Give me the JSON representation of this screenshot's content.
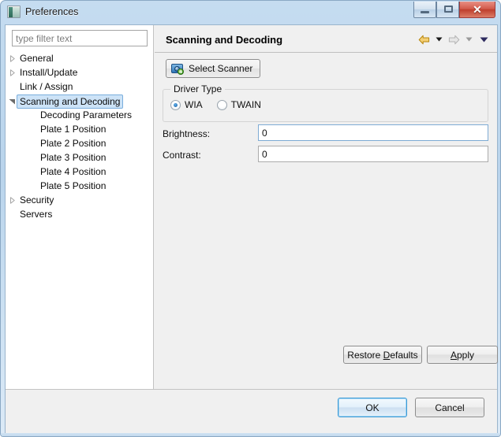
{
  "window": {
    "title": "Preferences",
    "icon": "preferences-window-icon",
    "controls": {
      "minimize": "minimize-icon",
      "maximize": "restore-icon",
      "close_label": "✕"
    }
  },
  "sidebar": {
    "filter": {
      "placeholder": "type filter text",
      "value": ""
    },
    "items": [
      {
        "label": "General",
        "indent": 0,
        "twisty": "collapsed",
        "selected": false
      },
      {
        "label": "Install/Update",
        "indent": 0,
        "twisty": "collapsed",
        "selected": false
      },
      {
        "label": "Link / Assign",
        "indent": 0,
        "twisty": "none",
        "selected": false
      },
      {
        "label": "Scanning and Decoding",
        "indent": 0,
        "twisty": "expanded",
        "selected": true
      },
      {
        "label": "Decoding Parameters",
        "indent": 1,
        "twisty": "none",
        "selected": false
      },
      {
        "label": "Plate 1 Position",
        "indent": 1,
        "twisty": "none",
        "selected": false
      },
      {
        "label": "Plate 2 Position",
        "indent": 1,
        "twisty": "none",
        "selected": false
      },
      {
        "label": "Plate 3 Position",
        "indent": 1,
        "twisty": "none",
        "selected": false
      },
      {
        "label": "Plate 4 Position",
        "indent": 1,
        "twisty": "none",
        "selected": false
      },
      {
        "label": "Plate 5 Position",
        "indent": 1,
        "twisty": "none",
        "selected": false
      },
      {
        "label": "Security",
        "indent": 0,
        "twisty": "collapsed",
        "selected": false
      },
      {
        "label": "Servers",
        "indent": 0,
        "twisty": "none",
        "selected": false
      }
    ]
  },
  "page": {
    "title": "Scanning and Decoding",
    "nav": {
      "back_icon": "back-arrow-icon",
      "back_menu_icon": "chevron-down-icon",
      "forward_icon": "forward-arrow-icon",
      "forward_menu_icon": "chevron-down-icon",
      "view_menu_icon": "chevron-down-icon"
    },
    "select_scanner": {
      "label": "Select Scanner",
      "icon": "scanner-camera-add-icon"
    },
    "driver_group": {
      "legend": "Driver Type",
      "options": [
        {
          "label": "WIA",
          "selected": true
        },
        {
          "label": "TWAIN",
          "selected": false
        }
      ]
    },
    "fields": [
      {
        "label": "Brightness:",
        "value": "0"
      },
      {
        "label": "Contrast:",
        "value": "0"
      }
    ],
    "restore_defaults": {
      "prefix": "Restore ",
      "mnemonic": "D",
      "suffix": "efaults"
    },
    "apply": {
      "prefix": "",
      "mnemonic": "A",
      "suffix": "pply"
    }
  },
  "footer": {
    "ok_label": "OK",
    "cancel_label": "Cancel"
  },
  "colors": {
    "accent_selection": "#cde3f7",
    "selection_border": "#7aaedd",
    "back_arrow": "#e8b33c",
    "forward_arrow_disabled": "#d6d6d6",
    "close_button": "#bf3f2d",
    "default_button_border": "#3c9ad6",
    "panel_background": "#f0f0f0",
    "list_background": "#ffffff"
  }
}
